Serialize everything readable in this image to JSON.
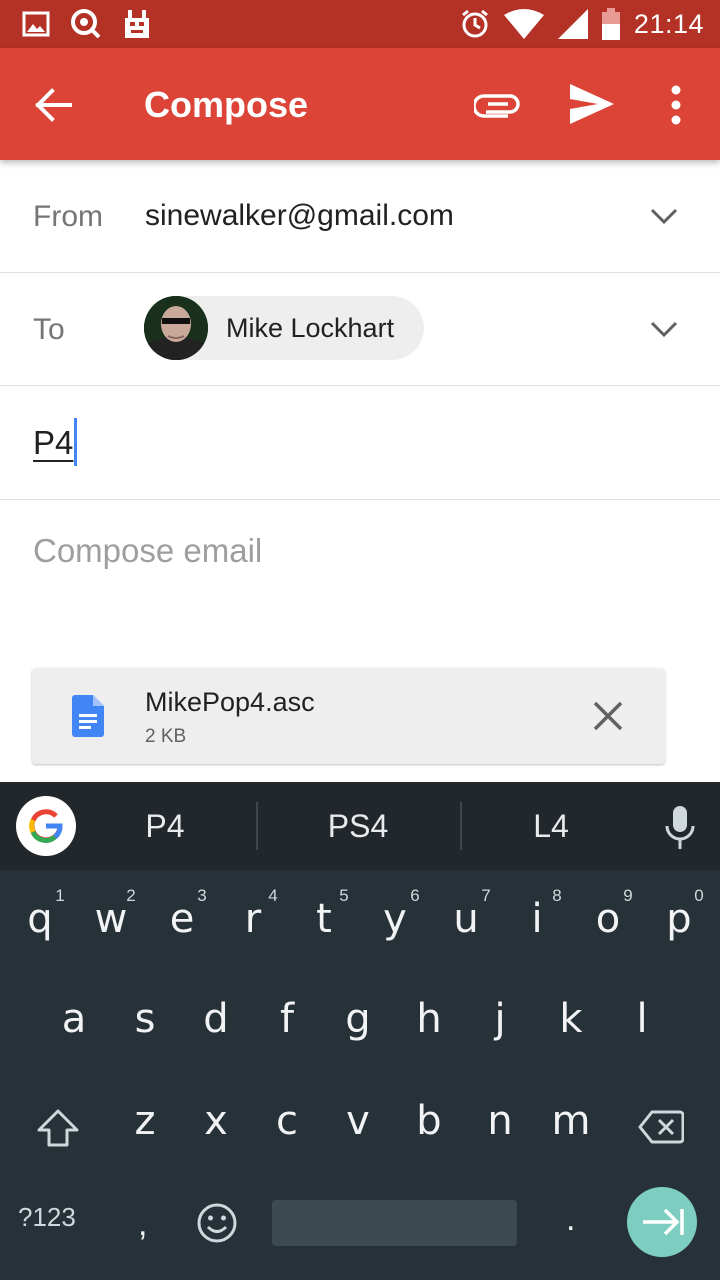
{
  "status_bar": {
    "time": "21:14",
    "left_icons": [
      "gallery-notification-icon",
      "quicksearch-notification-icon",
      "android-debug-icon"
    ],
    "right_icons": [
      "alarm-icon",
      "wifi-icon",
      "cell-signal-icon",
      "battery-icon"
    ]
  },
  "app_bar": {
    "title": "Compose",
    "color": "#db4437",
    "icons": [
      "back-arrow-icon",
      "attach-icon",
      "send-icon",
      "more-vert-icon"
    ]
  },
  "from": {
    "label": "From",
    "value": "sinewalker@gmail.com"
  },
  "to": {
    "label": "To",
    "recipient": "Mike Lockhart"
  },
  "subject": {
    "value": "P4"
  },
  "body": {
    "placeholder": "Compose email"
  },
  "attachment": {
    "name": "MikePop4.asc",
    "size": "2 KB"
  },
  "keyboard": {
    "suggestions": [
      "P4",
      "PS4",
      "L4"
    ],
    "row1": [
      {
        "k": "q",
        "h": "1"
      },
      {
        "k": "w",
        "h": "2"
      },
      {
        "k": "e",
        "h": "3"
      },
      {
        "k": "r",
        "h": "4"
      },
      {
        "k": "t",
        "h": "5"
      },
      {
        "k": "y",
        "h": "6"
      },
      {
        "k": "u",
        "h": "7"
      },
      {
        "k": "i",
        "h": "8"
      },
      {
        "k": "o",
        "h": "9"
      },
      {
        "k": "p",
        "h": "0"
      }
    ],
    "row2": [
      "a",
      "s",
      "d",
      "f",
      "g",
      "h",
      "j",
      "k",
      "l"
    ],
    "row3": [
      "z",
      "x",
      "c",
      "v",
      "b",
      "n",
      "m"
    ],
    "symbols_label": "?123",
    "comma": ",",
    "period": ".",
    "accent": "#7dcec1"
  }
}
